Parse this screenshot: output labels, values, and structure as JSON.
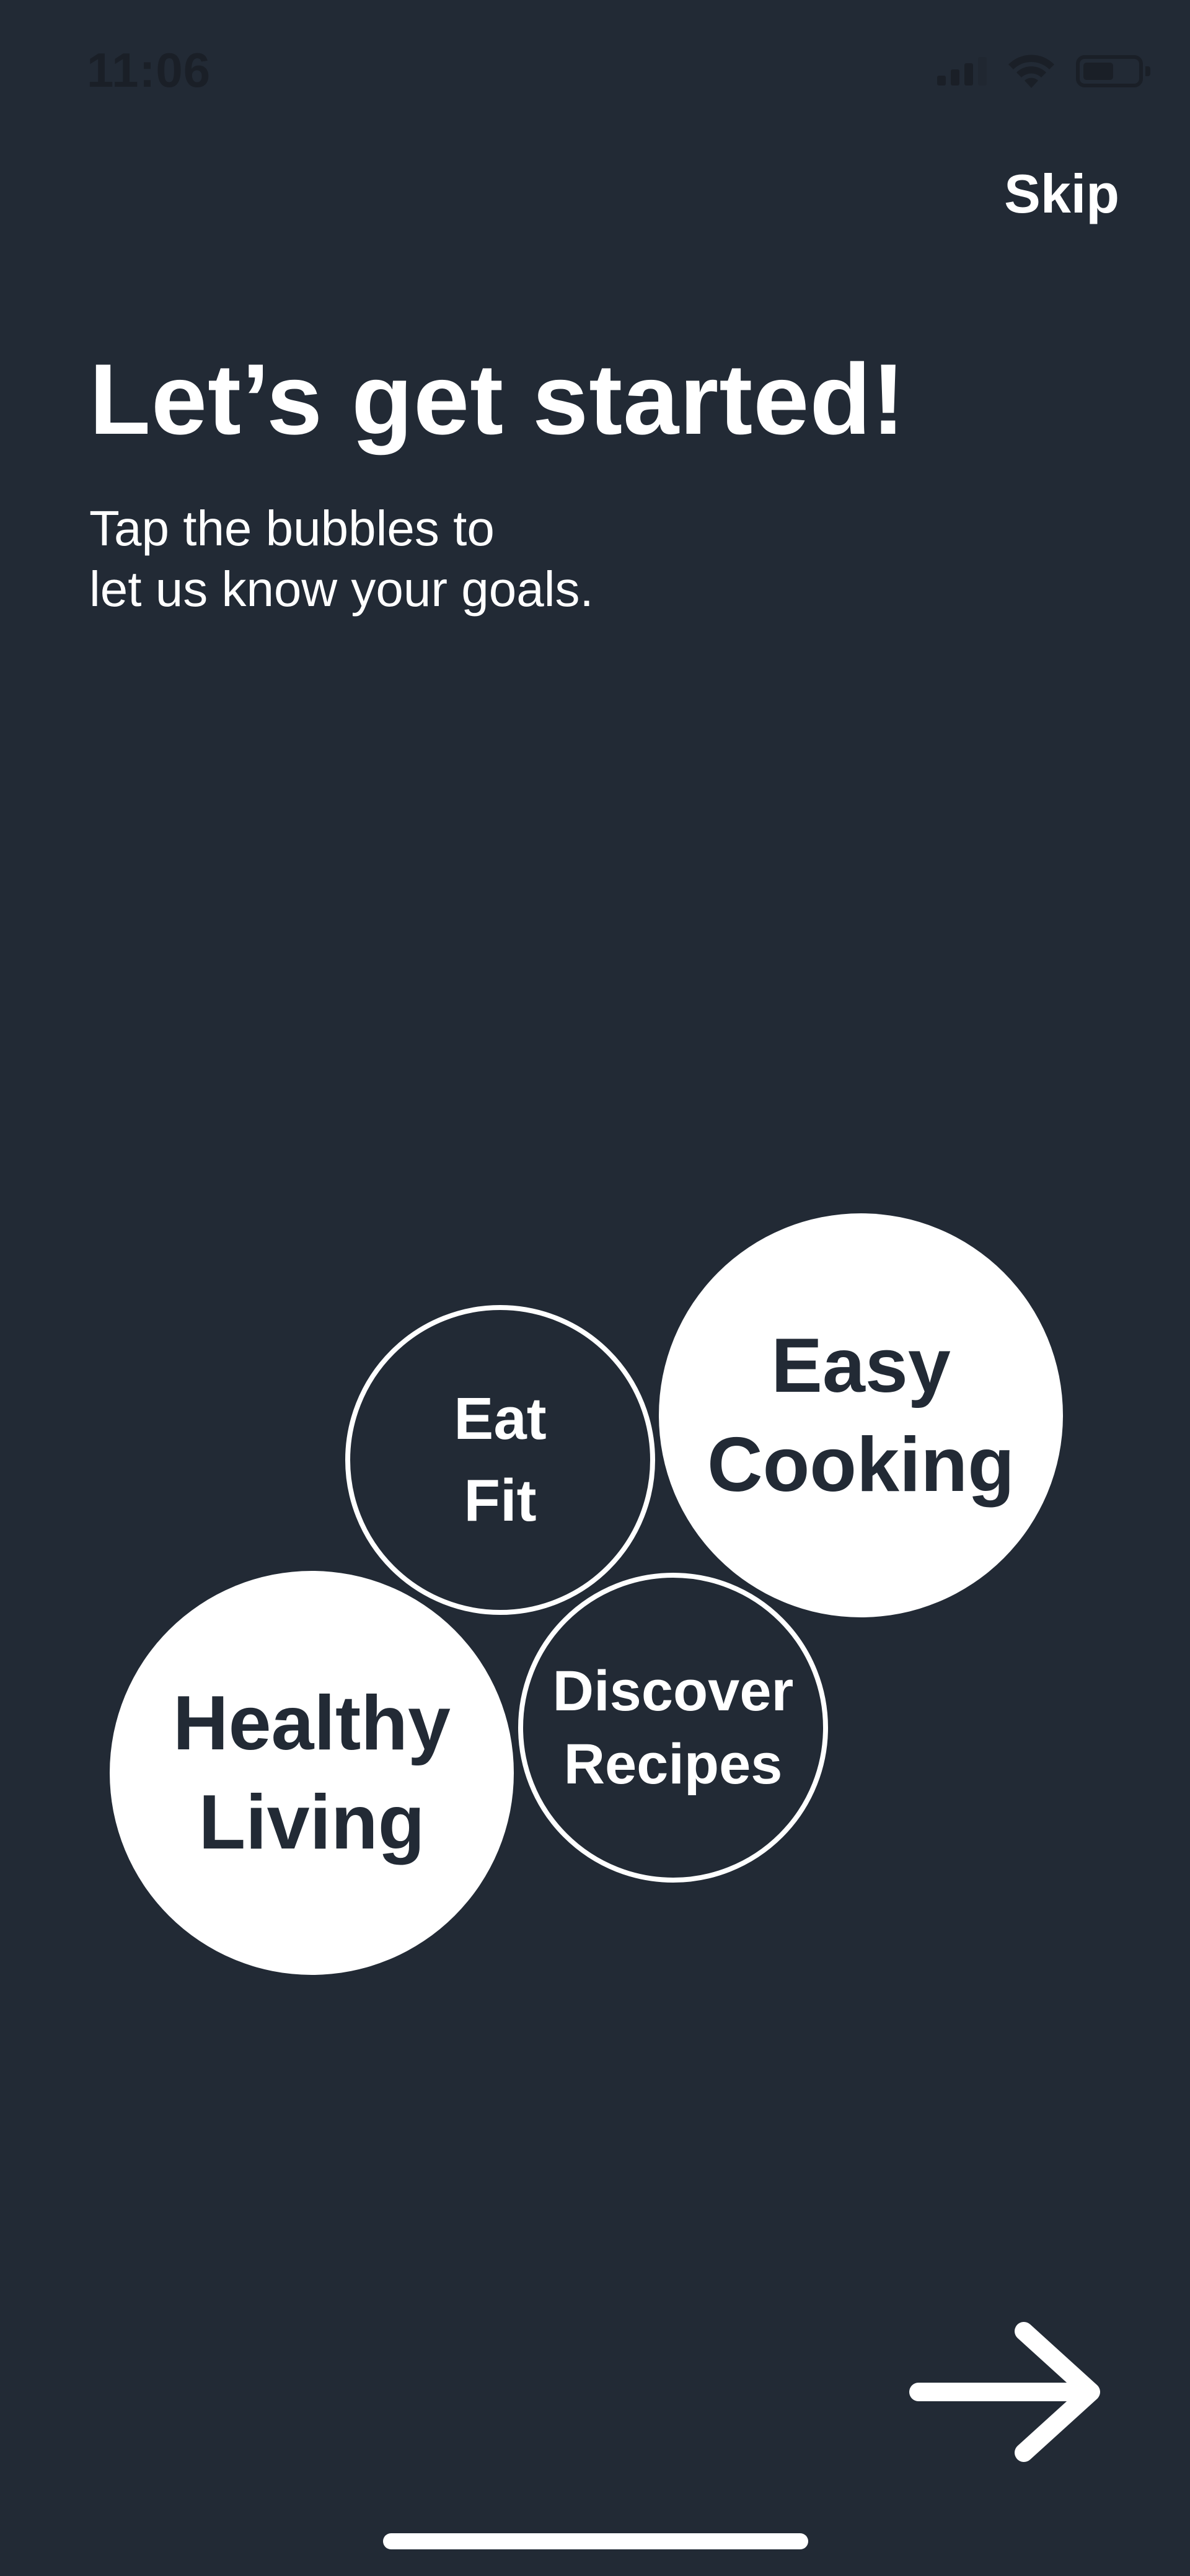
{
  "status_bar": {
    "time": "11:06",
    "icons": [
      "cellular-signal-icon",
      "wifi-icon",
      "battery-icon"
    ],
    "signal_bars_active": 3,
    "battery_level": 0.5
  },
  "header": {
    "skip_label": "Skip"
  },
  "intro": {
    "title": "Let’s get started!",
    "subtitle_line1": "Tap the bubbles to",
    "subtitle_line2": "let us know your goals."
  },
  "bubbles": [
    {
      "line1": "Easy",
      "line2": "Cooking",
      "selected": true
    },
    {
      "line1": "Eat",
      "line2": "Fit",
      "selected": false
    },
    {
      "line1": "Healthy",
      "line2": "Living",
      "selected": true
    },
    {
      "line1": "Discover",
      "line2": "Recipes",
      "selected": false
    }
  ],
  "footer": {
    "next_icon": "arrow-right-icon"
  },
  "colors": {
    "background": "#222a35",
    "foreground": "#ffffff",
    "status_bar_text": "#1a1f27"
  }
}
